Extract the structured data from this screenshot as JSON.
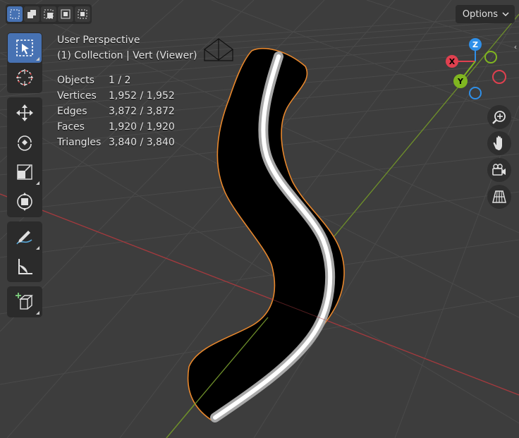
{
  "header": {
    "select_modes": [
      {
        "icon": "select-new-icon",
        "active": true
      },
      {
        "icon": "select-extend-icon",
        "active": false
      },
      {
        "icon": "select-subtract-icon",
        "active": false
      },
      {
        "icon": "select-difference-icon",
        "active": false
      },
      {
        "icon": "select-intersect-icon",
        "active": false
      }
    ],
    "options_label": "Options"
  },
  "overlay": {
    "view_name": "User Perspective",
    "collection_line": "(1) Collection | Vert (Viewer)"
  },
  "stats": [
    {
      "label": "Objects",
      "value": "1 / 2"
    },
    {
      "label": "Vertices",
      "value": "1,952 / 1,952"
    },
    {
      "label": "Edges",
      "value": "3,872 / 3,872"
    },
    {
      "label": "Faces",
      "value": "1,920 / 1,920"
    },
    {
      "label": "Triangles",
      "value": "3,840 / 3,840"
    }
  ],
  "gizmo": {
    "x_label": "X",
    "y_label": "Y",
    "z_label": "Z",
    "colors": {
      "x": "#e0404f",
      "y": "#80b620",
      "z": "#2f8fe8"
    }
  },
  "toolbar": [
    "select-box-icon",
    "cursor-icon",
    "move-icon",
    "rotate-icon",
    "scale-icon",
    "transform-icon",
    "annotate-icon",
    "measure-icon",
    "add-cube-icon"
  ],
  "nav_buttons": [
    "zoom-icon",
    "hand-pan-icon",
    "camera-icon",
    "grid-toggle-icon"
  ],
  "colors": {
    "accent": "#4772b3",
    "background": "#3d3d3d",
    "panel": "#2b2b2b",
    "selection_outline": "#e8872c"
  }
}
